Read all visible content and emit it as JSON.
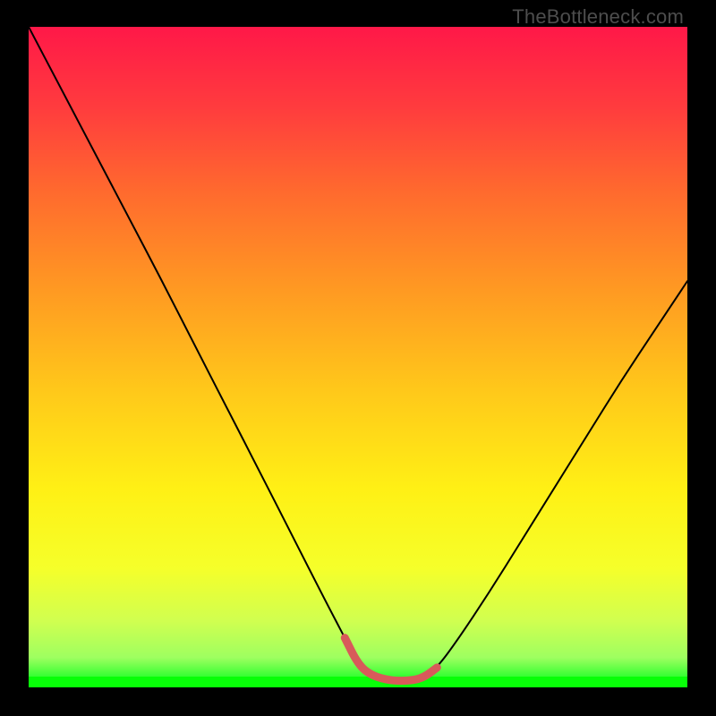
{
  "watermark": {
    "text": "TheBottleneck.com"
  },
  "colors": {
    "frame": "#000000",
    "watermark": "#4d4d4d",
    "curve_stroke": "#000000",
    "highlight_stroke": "#d85a5a",
    "green_band": "#08ff08",
    "gradient_stops": [
      {
        "offset": 0.0,
        "color": "#ff1848"
      },
      {
        "offset": 0.12,
        "color": "#ff3b3e"
      },
      {
        "offset": 0.25,
        "color": "#ff6a2e"
      },
      {
        "offset": 0.4,
        "color": "#ff9a22"
      },
      {
        "offset": 0.55,
        "color": "#ffc81a"
      },
      {
        "offset": 0.7,
        "color": "#fff015"
      },
      {
        "offset": 0.82,
        "color": "#f5ff2a"
      },
      {
        "offset": 0.9,
        "color": "#d0ff50"
      },
      {
        "offset": 0.955,
        "color": "#9eff60"
      },
      {
        "offset": 0.985,
        "color": "#30ff30"
      },
      {
        "offset": 1.0,
        "color": "#08ff08"
      }
    ]
  },
  "chart_data": {
    "type": "line",
    "title": "",
    "xlabel": "",
    "ylabel": "",
    "xlim": [
      0,
      100
    ],
    "ylim": [
      0,
      100
    ],
    "x": [
      0,
      5,
      10,
      15,
      20,
      25,
      30,
      35,
      40,
      45,
      48,
      50,
      52,
      55,
      58,
      60,
      62,
      65,
      70,
      75,
      80,
      85,
      90,
      95,
      100
    ],
    "values": [
      100,
      90.5,
      81,
      71.5,
      62,
      52.2,
      42.5,
      32.8,
      23,
      13.2,
      7.5,
      3.5,
      1.8,
      1.0,
      1.0,
      1.5,
      3.0,
      7.0,
      14.5,
      22.5,
      30.5,
      38.5,
      46.5,
      54.0,
      61.5
    ],
    "highlight_segment": {
      "x_start": 48,
      "x_end": 62
    },
    "annotations": [
      {
        "text": "TheBottleneck.com",
        "position": "top-right"
      }
    ]
  }
}
